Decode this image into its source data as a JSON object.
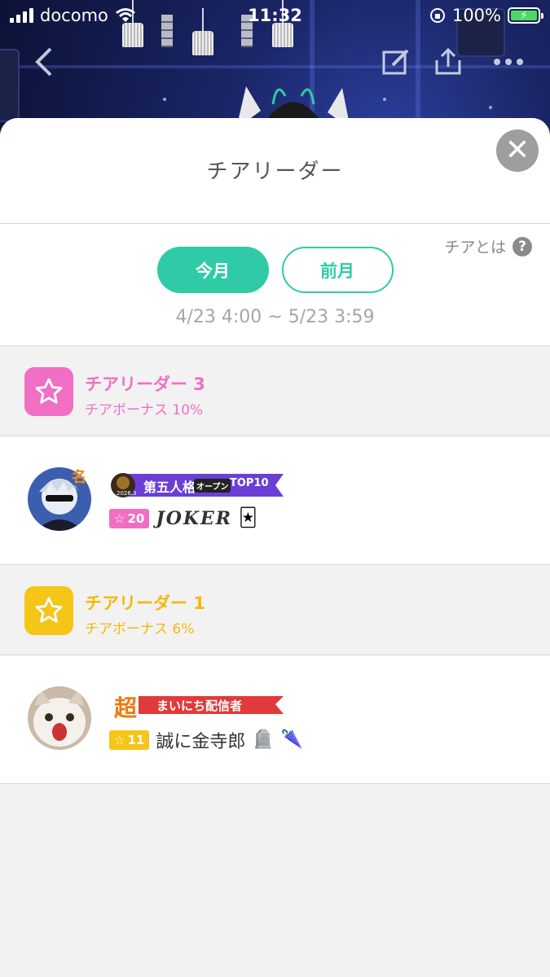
{
  "status_bar": {
    "carrier": "docomo",
    "time": "11:32",
    "battery": "100%"
  },
  "sheet": {
    "title": "チアリーダー",
    "help_text": "チアとは",
    "tabs": [
      {
        "label": "今月",
        "active": true
      },
      {
        "label": "前月",
        "active": false
      }
    ],
    "period_range": "4/23 4:00 ~ 5/23 3:59"
  },
  "levels": [
    {
      "title": "チアリーダー 3",
      "bonus": "チアボーナス 10%",
      "color": "#f06fc4",
      "users": [
        {
          "banner_text": "第五人格",
          "banner_sub": "オープン",
          "banner_tag": "TOP10",
          "banner_year": "2026.3",
          "level_chip": "20",
          "name": "JOKER",
          "emoji": "🃏"
        }
      ]
    },
    {
      "title": "チアリーダー 1",
      "bonus": "チアボーナス 6%",
      "color": "#f5b80c",
      "users": [
        {
          "banner_kanji": "超",
          "banner_text": "まいにち配信者",
          "level_chip": "11",
          "name": "誠に金寺郎",
          "emoji_1": "🪦",
          "emoji_2": "🌂"
        }
      ]
    }
  ]
}
